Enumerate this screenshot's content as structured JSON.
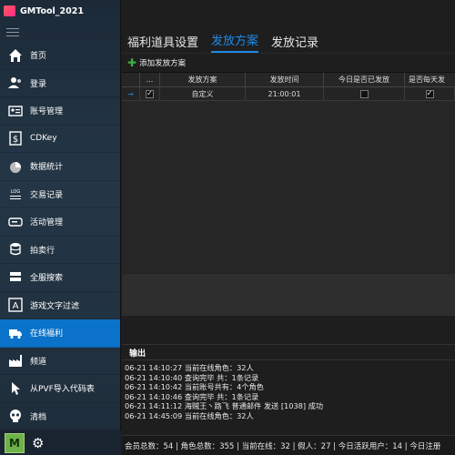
{
  "app": {
    "title": "GMTool_2021"
  },
  "sidebar": {
    "items": [
      {
        "label": "首页",
        "icon": "home-icon"
      },
      {
        "label": "登录",
        "icon": "users-icon"
      },
      {
        "label": "账号管理",
        "icon": "id-card-icon"
      },
      {
        "label": "CDKey",
        "icon": "dollar-icon"
      },
      {
        "label": "数据统计",
        "icon": "pie-chart-icon"
      },
      {
        "label": "交易记录",
        "icon": "log-icon"
      },
      {
        "label": "活动管理",
        "icon": "ticket-icon"
      },
      {
        "label": "拍卖行",
        "icon": "database-icon"
      },
      {
        "label": "全服搜索",
        "icon": "server-search-icon"
      },
      {
        "label": "游戏文字过滤",
        "icon": "text-filter-icon"
      },
      {
        "label": "在线福利",
        "icon": "truck-icon"
      },
      {
        "label": "频道",
        "icon": "factory-icon"
      },
      {
        "label": "从PVF导入代码表",
        "icon": "cursor-icon"
      },
      {
        "label": "清档",
        "icon": "skull-icon"
      }
    ],
    "active_index": 10,
    "user_initial": "M"
  },
  "tabs": [
    {
      "label": "福利道具设置"
    },
    {
      "label": "发放方案"
    },
    {
      "label": "发放记录"
    }
  ],
  "selected_tab": 1,
  "toolbar": {
    "add_label": "添加发放方案"
  },
  "grid": {
    "headers": [
      "...",
      "发放方案",
      "发放时间",
      "今日是否已发放",
      "是否每天发"
    ],
    "rows": [
      {
        "checked": true,
        "plan": "自定义",
        "time": "21:00:01",
        "issued_today": false,
        "daily": true
      }
    ]
  },
  "output": {
    "title": "输出",
    "lines": [
      "06-21 14:10:27 当前在线角色：32人",
      "06-21 14:10:40 查询完毕 共：1条记录",
      "06-21 14:10:42 当前账号共有：4个角色",
      "06-21 14:10:46 查询完毕 共：1条记录",
      "06-21 14:11:12 海贼王丶路飞 普通邮件 发送 [1038] 成功",
      "06-21 14:45:09 当前在线角色：32人"
    ]
  },
  "status": {
    "text": "会员总数：54 | 角色总数：355 | 当前在线：32 | 假人：27 | 今日活跃用户：14 | 今日注册"
  },
  "colors": {
    "accent": "#1e8ae6",
    "active_nav": "#0a72c8",
    "add_icon": "#3cb043"
  }
}
